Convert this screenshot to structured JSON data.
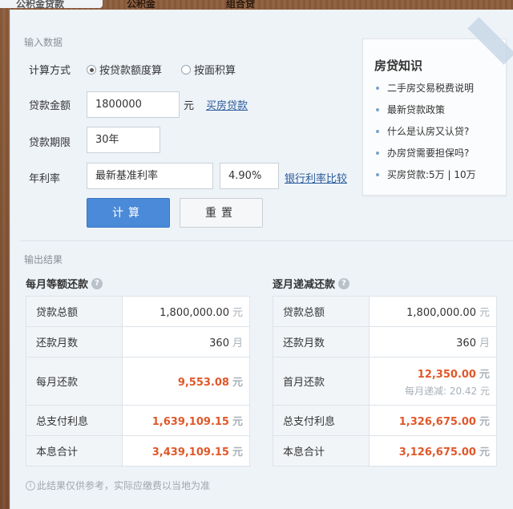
{
  "tabs": [
    "公积金贷款",
    "公积金",
    "组合贷"
  ],
  "input_section": {
    "title": "输入数据",
    "calc_method_label": "计算方式",
    "calc_options": [
      {
        "label": "按贷款额度算",
        "selected": true
      },
      {
        "label": "按面积算",
        "selected": false
      }
    ],
    "loan_amount_label": "贷款金额",
    "loan_amount_value": "1800000",
    "loan_amount_unit": "元",
    "buy_loan_link": "买房贷款",
    "term_label": "贷款期限",
    "term_value": "30年",
    "rate_label": "年利率",
    "rate_type_value": "最新基准利率",
    "rate_value": "4.90%",
    "rate_compare_link": "银行利率比较",
    "calc_button": "计算",
    "reset_button": "重置"
  },
  "knowledge": {
    "title": "房贷知识",
    "items": [
      "二手房交易税费说明",
      "最新贷款政策",
      "什么是认房又认贷?",
      "办房贷需要担保吗?",
      "买房贷款:5万 | 10万"
    ]
  },
  "output_section": {
    "title": "输出结果",
    "equal_payment": {
      "title": "每月等额还款",
      "rows": [
        {
          "k": "贷款总额",
          "v": "1,800,000.00",
          "u": "元"
        },
        {
          "k": "还款月数",
          "v": "360",
          "u": "月"
        },
        {
          "k": "每月还款",
          "v": "9,553.08",
          "u": "元"
        },
        {
          "k": "总支付利息",
          "v": "1,639,109.15",
          "u": "元"
        },
        {
          "k": "本息合计",
          "v": "3,439,109.15",
          "u": "元"
        }
      ]
    },
    "decreasing_payment": {
      "title": "逐月递减还款",
      "rows": [
        {
          "k": "贷款总额",
          "v": "1,800,000.00",
          "u": "元"
        },
        {
          "k": "还款月数",
          "v": "360",
          "u": "月"
        },
        {
          "k": "首月还款",
          "v": "12,350.00",
          "u": "元",
          "sub": "每月递减: 20.42 元"
        },
        {
          "k": "总支付利息",
          "v": "1,326,675.00",
          "u": "元"
        },
        {
          "k": "本息合计",
          "v": "3,126,675.00",
          "u": "元"
        }
      ]
    },
    "note": "此结果仅供参考，实际应缴费以当地为准"
  },
  "colors": {
    "accent": "#4a8ad8",
    "highlight": "#e0582a",
    "wood": "#8a5a3a"
  }
}
